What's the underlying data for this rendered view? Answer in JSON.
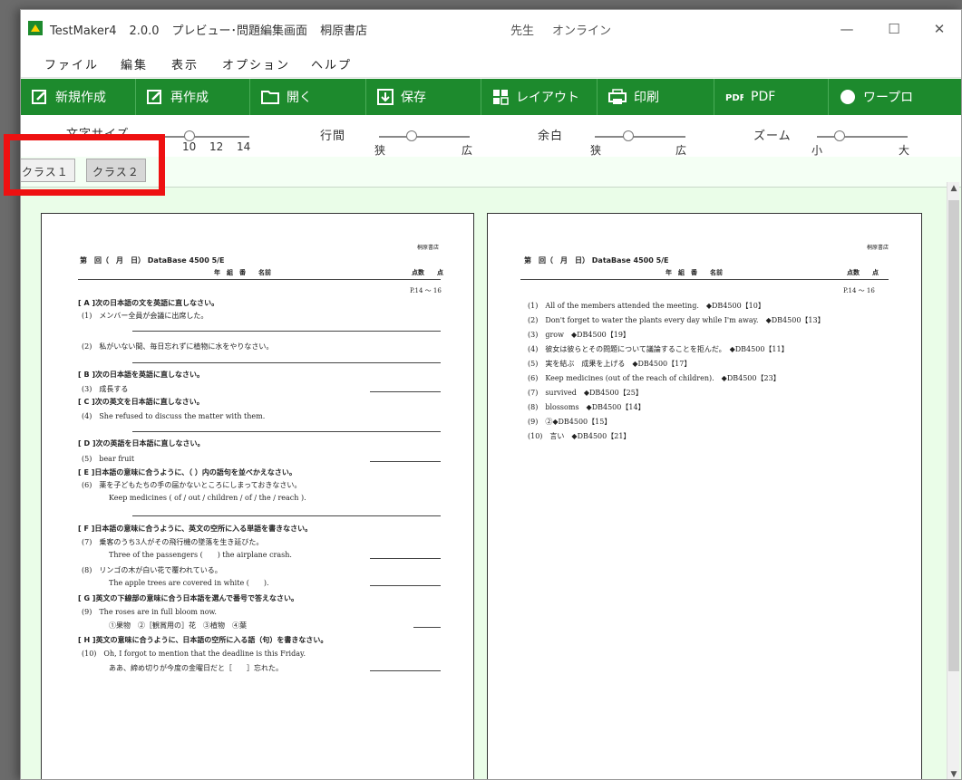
{
  "titlebar": {
    "app_name": "TestMaker4",
    "version": "2.0.0",
    "screen": "プレビュー･問題編集画面",
    "publisher": "桐原書店",
    "user": "先生",
    "status": "オンライン",
    "min_glyph": "—",
    "max_glyph": "☐",
    "close_glyph": "✕"
  },
  "menu": [
    "ファイル",
    "編集",
    "表示",
    "オプション",
    "ヘルプ"
  ],
  "toolbar": {
    "new": "新規作成",
    "recreate": "再作成",
    "open": "開く",
    "save": "保存",
    "layout": "レイアウト",
    "print": "印刷",
    "pdf": "PDF",
    "wordpro": "ワープロ"
  },
  "settings": {
    "font_size_label": "文字サイズ",
    "font_ticks": [
      "10",
      "12",
      "14"
    ],
    "line_label": "行間",
    "line_ticks": [
      "狭",
      "広"
    ],
    "margin_label": "余白",
    "margin_ticks": [
      "狭",
      "広"
    ],
    "zoom_label": "ズーム",
    "zoom_ticks": [
      "小",
      "大"
    ]
  },
  "tabs": [
    "クラス１",
    "クラス２"
  ],
  "colors": {
    "toolbar": "#1d8a2d",
    "content_bg": "#eafde8",
    "highlight": "#ee1111"
  },
  "left_page": {
    "publisher": "桐原書店",
    "header": "第　回（　月　日） DataBase 4500 5/E",
    "header_fields": "年　組　番　　名前",
    "score": "点数　　点",
    "range": "P.14 〜 16",
    "lines": [
      "[ A ]次の日本語の文を英語に直しなさい。",
      "(1)　メンバー全員が会議に出席した。",
      "(2)　私がいない間、毎日忘れずに植物に水をやりなさい。",
      "[ B ]次の日本語を英語に直しなさい。",
      "(3)　成長する",
      "[ C ]次の英文を日本語に直しなさい。",
      "(4)　She refused to discuss the matter with them.",
      "[ D ]次の英語を日本語に直しなさい。",
      "(5)　bear fruit",
      "[ E ]日本語の意味に合うように、（ ）内の語句を並べかえなさい。",
      "(6)　薬を子どもたちの手の届かないところにしまっておきなさい。",
      "Keep medicines ( of / out / children / of / the / reach ).",
      "[ F ]日本語の意味に合うように、英文の空所に入る単語を書きなさい。",
      "(7)　乗客のうち3人がその飛行機の墜落を生き延びた。",
      "Three of the passengers (　　) the airplane crash.",
      "(8)　リンゴの木が白い花で覆われている。",
      "The apple trees are covered in white (　　).",
      "[ G ]英文の下線部の意味に合う日本語を選んで番号で答えなさい。",
      "(9)　The roses are in full bloom now.",
      "①果物　②［観賞用の］花　③植物　④葉",
      "[ H ]英文の意味に合うように、日本語の空所に入る語（句）を書きなさい。",
      "(10)　Oh, I forgot to mention that the deadline is this Friday.",
      "ああ、締め切りが今度の金曜日だと［　　］忘れた。"
    ]
  },
  "right_page": {
    "publisher": "桐原書店",
    "header": "第　回（　月　日） DataBase 4500 5/E",
    "header_fields": "年　組　番　　名前",
    "score": "点数　　点",
    "range": "P.14 〜 16",
    "answers": [
      "(1)　All of the members attended the meeting.　◆DB4500【10】",
      "(2)　Don't forget to water the plants every day while I'm away.　◆DB4500【13】",
      "(3)　grow　◆DB4500【19】",
      "(4)　彼女は彼らとその問題について議論することを拒んだ。　◆DB4500【11】",
      "(5)　実を結ぶ　成果を上げる　◆DB4500【17】",
      "(6)　Keep medicines (out of the reach of children).　◆DB4500【23】",
      "(7)　survived　◆DB4500【25】",
      "(8)　blossoms　◆DB4500【14】",
      "(9)　②◆DB4500【15】",
      "(10)　言い　◆DB4500【21】"
    ]
  }
}
